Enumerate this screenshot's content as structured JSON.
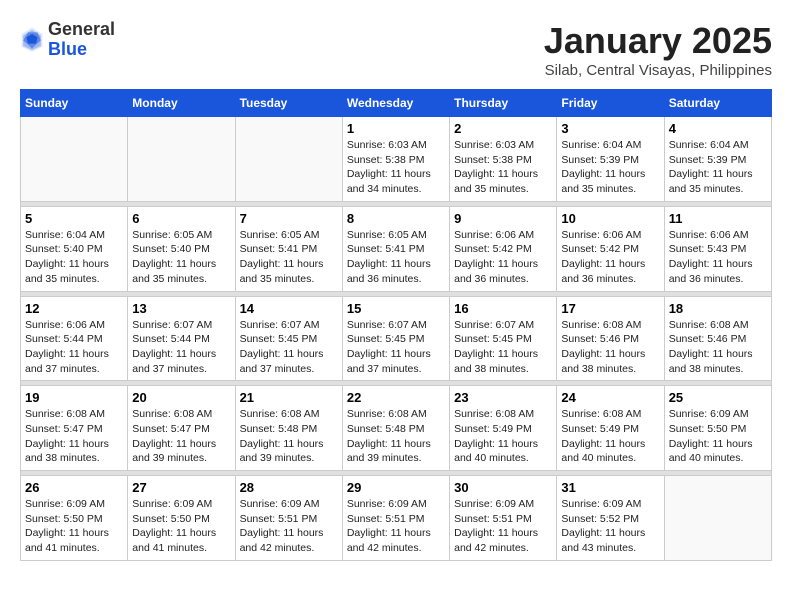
{
  "logo": {
    "general": "General",
    "blue": "Blue"
  },
  "header": {
    "month": "January 2025",
    "location": "Silab, Central Visayas, Philippines"
  },
  "weekdays": [
    "Sunday",
    "Monday",
    "Tuesday",
    "Wednesday",
    "Thursday",
    "Friday",
    "Saturday"
  ],
  "weeks": [
    [
      {
        "day": "",
        "sunrise": "",
        "sunset": "",
        "daylight": ""
      },
      {
        "day": "",
        "sunrise": "",
        "sunset": "",
        "daylight": ""
      },
      {
        "day": "",
        "sunrise": "",
        "sunset": "",
        "daylight": ""
      },
      {
        "day": "1",
        "sunrise": "6:03 AM",
        "sunset": "5:38 PM",
        "daylight": "11 hours and 34 minutes."
      },
      {
        "day": "2",
        "sunrise": "6:03 AM",
        "sunset": "5:38 PM",
        "daylight": "11 hours and 35 minutes."
      },
      {
        "day": "3",
        "sunrise": "6:04 AM",
        "sunset": "5:39 PM",
        "daylight": "11 hours and 35 minutes."
      },
      {
        "day": "4",
        "sunrise": "6:04 AM",
        "sunset": "5:39 PM",
        "daylight": "11 hours and 35 minutes."
      }
    ],
    [
      {
        "day": "5",
        "sunrise": "6:04 AM",
        "sunset": "5:40 PM",
        "daylight": "11 hours and 35 minutes."
      },
      {
        "day": "6",
        "sunrise": "6:05 AM",
        "sunset": "5:40 PM",
        "daylight": "11 hours and 35 minutes."
      },
      {
        "day": "7",
        "sunrise": "6:05 AM",
        "sunset": "5:41 PM",
        "daylight": "11 hours and 35 minutes."
      },
      {
        "day": "8",
        "sunrise": "6:05 AM",
        "sunset": "5:41 PM",
        "daylight": "11 hours and 36 minutes."
      },
      {
        "day": "9",
        "sunrise": "6:06 AM",
        "sunset": "5:42 PM",
        "daylight": "11 hours and 36 minutes."
      },
      {
        "day": "10",
        "sunrise": "6:06 AM",
        "sunset": "5:42 PM",
        "daylight": "11 hours and 36 minutes."
      },
      {
        "day": "11",
        "sunrise": "6:06 AM",
        "sunset": "5:43 PM",
        "daylight": "11 hours and 36 minutes."
      }
    ],
    [
      {
        "day": "12",
        "sunrise": "6:06 AM",
        "sunset": "5:44 PM",
        "daylight": "11 hours and 37 minutes."
      },
      {
        "day": "13",
        "sunrise": "6:07 AM",
        "sunset": "5:44 PM",
        "daylight": "11 hours and 37 minutes."
      },
      {
        "day": "14",
        "sunrise": "6:07 AM",
        "sunset": "5:45 PM",
        "daylight": "11 hours and 37 minutes."
      },
      {
        "day": "15",
        "sunrise": "6:07 AM",
        "sunset": "5:45 PM",
        "daylight": "11 hours and 37 minutes."
      },
      {
        "day": "16",
        "sunrise": "6:07 AM",
        "sunset": "5:45 PM",
        "daylight": "11 hours and 38 minutes."
      },
      {
        "day": "17",
        "sunrise": "6:08 AM",
        "sunset": "5:46 PM",
        "daylight": "11 hours and 38 minutes."
      },
      {
        "day": "18",
        "sunrise": "6:08 AM",
        "sunset": "5:46 PM",
        "daylight": "11 hours and 38 minutes."
      }
    ],
    [
      {
        "day": "19",
        "sunrise": "6:08 AM",
        "sunset": "5:47 PM",
        "daylight": "11 hours and 38 minutes."
      },
      {
        "day": "20",
        "sunrise": "6:08 AM",
        "sunset": "5:47 PM",
        "daylight": "11 hours and 39 minutes."
      },
      {
        "day": "21",
        "sunrise": "6:08 AM",
        "sunset": "5:48 PM",
        "daylight": "11 hours and 39 minutes."
      },
      {
        "day": "22",
        "sunrise": "6:08 AM",
        "sunset": "5:48 PM",
        "daylight": "11 hours and 39 minutes."
      },
      {
        "day": "23",
        "sunrise": "6:08 AM",
        "sunset": "5:49 PM",
        "daylight": "11 hours and 40 minutes."
      },
      {
        "day": "24",
        "sunrise": "6:08 AM",
        "sunset": "5:49 PM",
        "daylight": "11 hours and 40 minutes."
      },
      {
        "day": "25",
        "sunrise": "6:09 AM",
        "sunset": "5:50 PM",
        "daylight": "11 hours and 40 minutes."
      }
    ],
    [
      {
        "day": "26",
        "sunrise": "6:09 AM",
        "sunset": "5:50 PM",
        "daylight": "11 hours and 41 minutes."
      },
      {
        "day": "27",
        "sunrise": "6:09 AM",
        "sunset": "5:50 PM",
        "daylight": "11 hours and 41 minutes."
      },
      {
        "day": "28",
        "sunrise": "6:09 AM",
        "sunset": "5:51 PM",
        "daylight": "11 hours and 42 minutes."
      },
      {
        "day": "29",
        "sunrise": "6:09 AM",
        "sunset": "5:51 PM",
        "daylight": "11 hours and 42 minutes."
      },
      {
        "day": "30",
        "sunrise": "6:09 AM",
        "sunset": "5:51 PM",
        "daylight": "11 hours and 42 minutes."
      },
      {
        "day": "31",
        "sunrise": "6:09 AM",
        "sunset": "5:52 PM",
        "daylight": "11 hours and 43 minutes."
      },
      {
        "day": "",
        "sunrise": "",
        "sunset": "",
        "daylight": ""
      }
    ]
  ],
  "labels": {
    "sunrise": "Sunrise:",
    "sunset": "Sunset:",
    "daylight": "Daylight:"
  }
}
